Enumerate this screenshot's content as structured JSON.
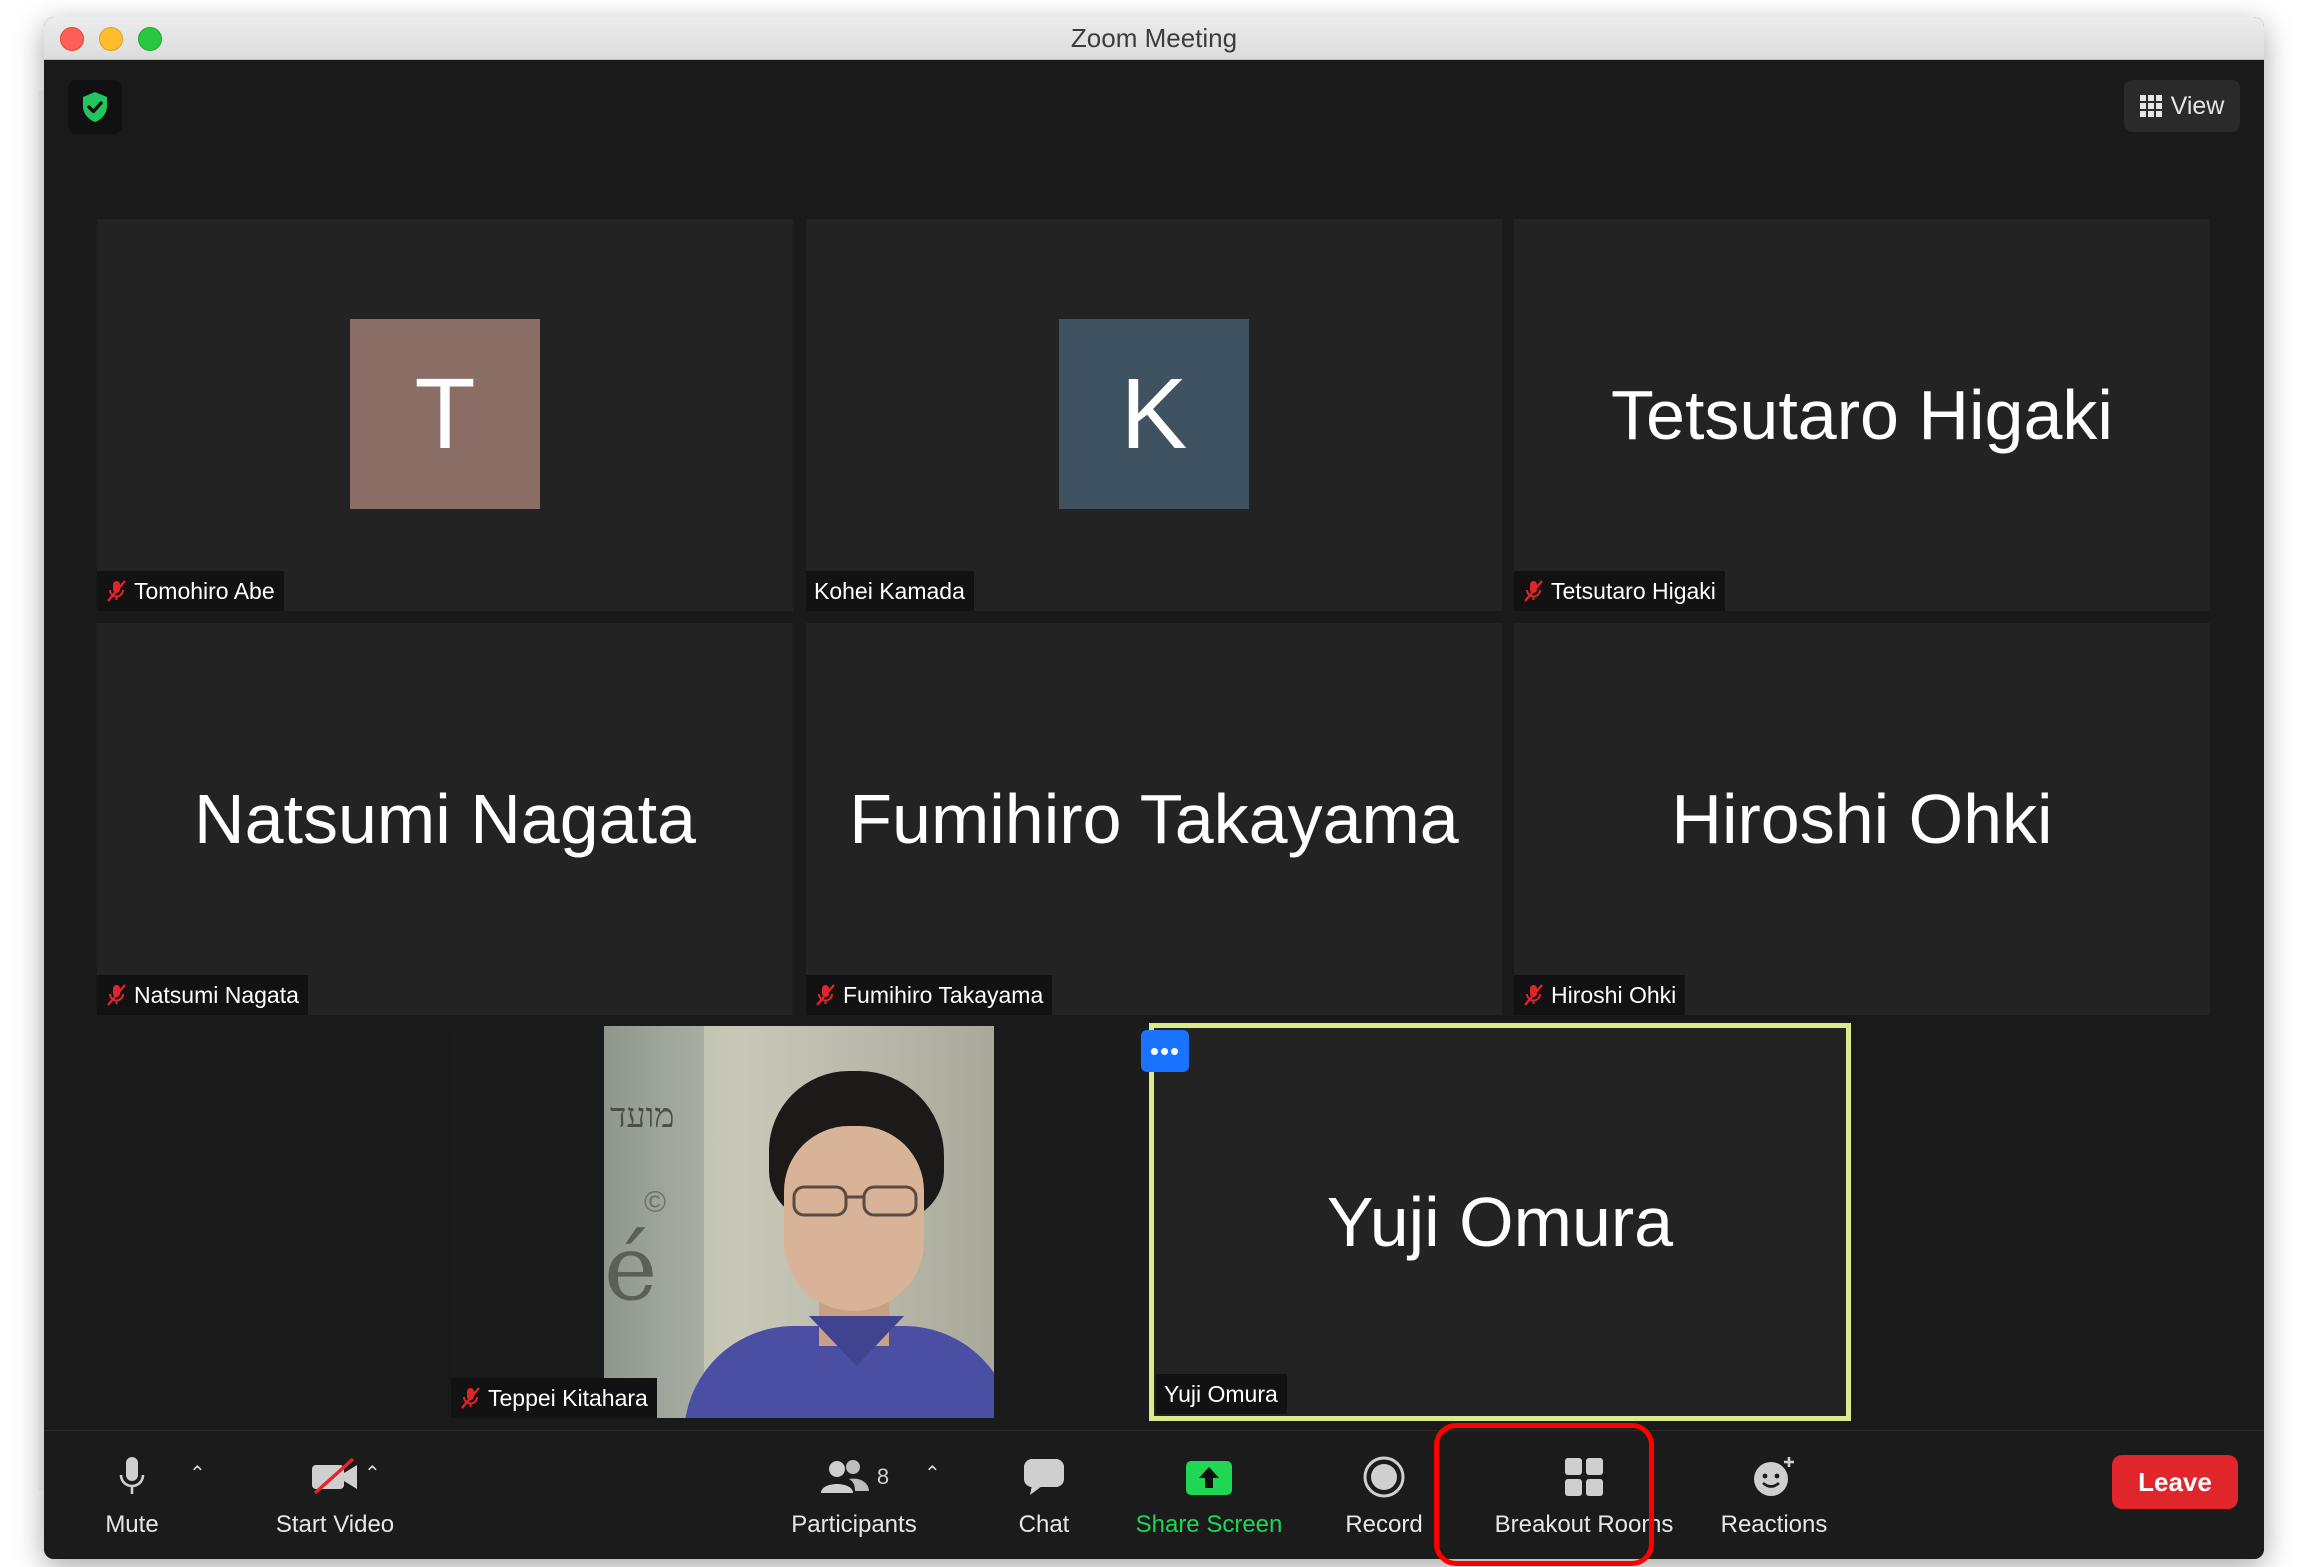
{
  "window": {
    "title": "Zoom Meeting"
  },
  "header": {
    "view_label": "View"
  },
  "tiles": [
    {
      "name": "Tomohiro Abe",
      "avatar_letter": "T",
      "avatar_color": "#8a6e65",
      "muted": true
    },
    {
      "name": "Kohei Kamada",
      "avatar_letter": "K",
      "avatar_color": "#3f5261",
      "muted": false
    },
    {
      "name": "Tetsutaro Higaki",
      "display": "Tetsutaro Higaki",
      "muted": true
    },
    {
      "name": "Natsumi Nagata",
      "display": "Natsumi Nagata",
      "muted": true
    },
    {
      "name": "Fumihiro Takayama",
      "display": "Fumihiro Takayama",
      "muted": true
    },
    {
      "name": "Hiroshi Ohki",
      "display": "Hiroshi Ohki",
      "muted": true
    },
    {
      "name": "Teppei Kitahara",
      "muted": true,
      "video_on": true
    },
    {
      "name": "Yuji Omura",
      "display": "Yuji Omura",
      "muted": false,
      "active_speaker": true
    }
  ],
  "toolbar": {
    "mute": "Mute",
    "start_video": "Start Video",
    "participants": "Participants",
    "participants_count": "8",
    "chat": "Chat",
    "share_screen": "Share Screen",
    "record": "Record",
    "breakout_rooms": "Breakout Rooms",
    "reactions": "Reactions",
    "leave": "Leave"
  },
  "colors": {
    "accent_green": "#1fd655",
    "leave_red": "#e0252b",
    "active_speaker_border": "#dbea8c",
    "highlight_box": "#ff0000",
    "more_button": "#1a73ff"
  },
  "background_photo_text": {
    "sign_top": "מועד",
    "sign_letter": "é",
    "sign_copyright": "©"
  },
  "more_button": {
    "label": "•••"
  }
}
